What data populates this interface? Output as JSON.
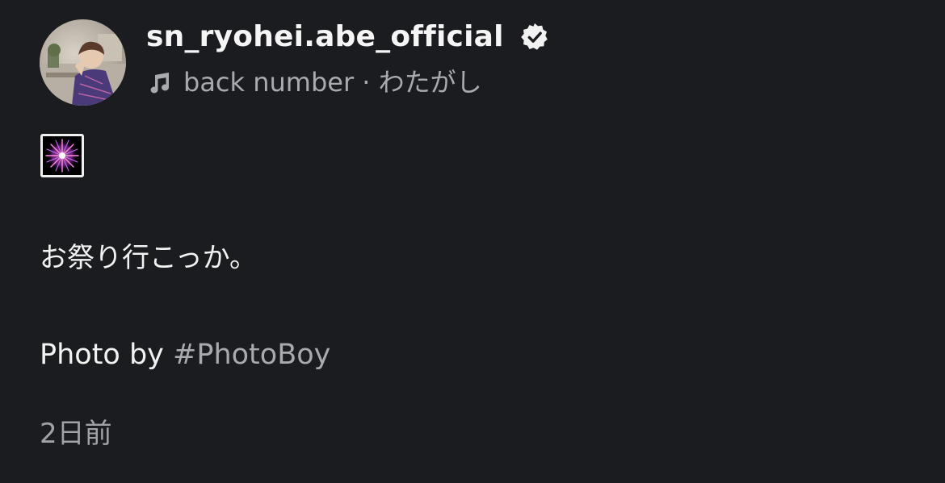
{
  "post": {
    "username": "sn_ryohei.abe_official",
    "verified_icon": "verified-badge-icon",
    "music": {
      "icon": "music-note-icon",
      "text": "back number · わたがし"
    },
    "emoji": "firework-icon",
    "caption": "お祭り行こっか。",
    "credit": {
      "prefix": "Photo by ",
      "hashtag": "#PhotoBoy"
    },
    "timestamp": "2日前"
  },
  "colors": {
    "background": "#1a1c1f",
    "text": "#f2f2f2",
    "secondary_text": "#a8aab0",
    "hashtag": "#a8aab0"
  }
}
